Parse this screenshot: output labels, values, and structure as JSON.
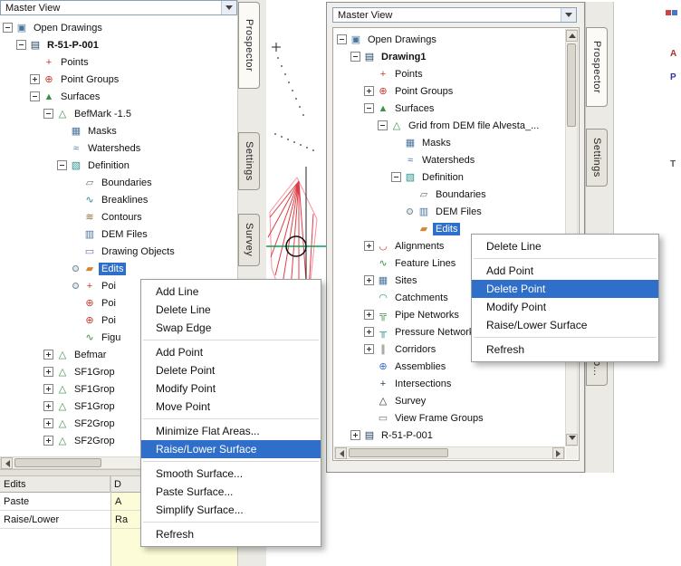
{
  "left_panel": {
    "view_selector": "Master View",
    "tabs": [
      {
        "label": "Prospector",
        "active": true
      },
      {
        "label": "Settings",
        "active": false
      },
      {
        "label": "Survey",
        "active": false
      }
    ],
    "tree": {
      "rows": [
        {
          "label": "Open Drawings",
          "level": 0,
          "expander": "minus",
          "icon": "open_drawings"
        },
        {
          "label": "R-51-P-001",
          "level": 1,
          "expander": "minus",
          "icon": "drawing",
          "bold": true
        },
        {
          "label": "Points",
          "level": 2,
          "expander": null,
          "icon": "points"
        },
        {
          "label": "Point Groups",
          "level": 2,
          "expander": "plus",
          "icon": "point_groups"
        },
        {
          "label": "Surfaces",
          "level": 2,
          "expander": "minus",
          "icon": "surfaces"
        },
        {
          "label": "BefMark -1.5",
          "level": 3,
          "expander": "minus",
          "icon": "surface"
        },
        {
          "label": "Masks",
          "level": 4,
          "expander": null,
          "icon": "masks"
        },
        {
          "label": "Watersheds",
          "level": 4,
          "expander": null,
          "icon": "watersheds"
        },
        {
          "label": "Definition",
          "level": 4,
          "expander": "minus",
          "icon": "definition"
        },
        {
          "label": "Boundaries",
          "level": 5,
          "expander": null,
          "icon": "boundaries"
        },
        {
          "label": "Breaklines",
          "level": 5,
          "expander": null,
          "icon": "breaklines"
        },
        {
          "label": "Contours",
          "level": 5,
          "expander": null,
          "icon": "contours"
        },
        {
          "label": "DEM Files",
          "level": 5,
          "expander": null,
          "icon": "dem_files"
        },
        {
          "label": "Drawing Objects",
          "level": 5,
          "expander": null,
          "icon": "drawing_objects"
        },
        {
          "label": "Edits",
          "level": 5,
          "expander": null,
          "icon": "edits",
          "selected": true,
          "bullet": true
        },
        {
          "label": "Poi",
          "level": 5,
          "expander": null,
          "icon": "point_files",
          "bullet": true,
          "truncated": true
        },
        {
          "label": "Poi",
          "level": 5,
          "expander": null,
          "icon": "point_groups",
          "truncated": true
        },
        {
          "label": "Poi",
          "level": 5,
          "expander": null,
          "icon": "point_groups",
          "truncated": true
        },
        {
          "label": "Figu",
          "level": 5,
          "expander": null,
          "icon": "figures",
          "truncated": true
        },
        {
          "label": "Befmar",
          "level": 3,
          "expander": "plus",
          "icon": "surface",
          "truncated": true
        },
        {
          "label": "SF1Grop",
          "level": 3,
          "expander": "plus",
          "icon": "surface",
          "truncated": true
        },
        {
          "label": "SF1Grop",
          "level": 3,
          "expander": "plus",
          "icon": "surface",
          "truncated": true
        },
        {
          "label": "SF1Grop",
          "level": 3,
          "expander": "plus",
          "icon": "surface",
          "truncated": true
        },
        {
          "label": "SF2Grop",
          "level": 3,
          "expander": "plus",
          "icon": "surface",
          "truncated": true
        },
        {
          "label": "SF2Grop",
          "level": 3,
          "expander": "plus",
          "icon": "surface",
          "truncated": true
        }
      ]
    },
    "list": {
      "columns": [
        "Edits",
        "D"
      ],
      "rows": [
        [
          "Paste",
          "A"
        ],
        [
          "Raise/Lower",
          "Ra"
        ]
      ]
    }
  },
  "right_panel": {
    "view_selector": "Master View",
    "tabs": [
      {
        "label": "Prospector",
        "active": true
      },
      {
        "label": "Settings",
        "active": false
      },
      {
        "label": "To...",
        "active": false
      }
    ],
    "tree": {
      "rows": [
        {
          "label": "Open Drawings",
          "level": 0,
          "expander": "minus",
          "icon": "open_drawings"
        },
        {
          "label": "Drawing1",
          "level": 1,
          "expander": "minus",
          "icon": "drawing",
          "bold": true
        },
        {
          "label": "Points",
          "level": 2,
          "expander": null,
          "icon": "points"
        },
        {
          "label": "Point Groups",
          "level": 2,
          "expander": "plus",
          "icon": "point_groups"
        },
        {
          "label": "Surfaces",
          "level": 2,
          "expander": "minus",
          "icon": "surfaces"
        },
        {
          "label": "Grid from DEM file Alvesta_...",
          "level": 3,
          "expander": "minus",
          "icon": "surface"
        },
        {
          "label": "Masks",
          "level": 4,
          "expander": null,
          "icon": "masks"
        },
        {
          "label": "Watersheds",
          "level": 4,
          "expander": null,
          "icon": "watersheds"
        },
        {
          "label": "Definition",
          "level": 4,
          "expander": "minus",
          "icon": "definition"
        },
        {
          "label": "Boundaries",
          "level": 5,
          "expander": null,
          "icon": "boundaries"
        },
        {
          "label": "DEM Files",
          "level": 5,
          "expander": null,
          "icon": "dem_files",
          "bullet": true
        },
        {
          "label": "Edits",
          "level": 5,
          "expander": null,
          "icon": "edits",
          "selected": true
        },
        {
          "label": "Alignments",
          "level": 2,
          "expander": "plus",
          "icon": "alignments"
        },
        {
          "label": "Feature Lines",
          "level": 2,
          "expander": null,
          "icon": "feature_lines"
        },
        {
          "label": "Sites",
          "level": 2,
          "expander": "plus",
          "icon": "sites"
        },
        {
          "label": "Catchments",
          "level": 2,
          "expander": null,
          "icon": "catchments"
        },
        {
          "label": "Pipe Networks",
          "level": 2,
          "expander": "plus",
          "icon": "pipe_networks"
        },
        {
          "label": "Pressure Networks",
          "level": 2,
          "expander": "plus",
          "icon": "pressure_networks"
        },
        {
          "label": "Corridors",
          "level": 2,
          "expander": "plus",
          "icon": "corridors"
        },
        {
          "label": "Assemblies",
          "level": 2,
          "expander": null,
          "icon": "assemblies"
        },
        {
          "label": "Intersections",
          "level": 2,
          "expander": null,
          "icon": "intersections"
        },
        {
          "label": "Survey",
          "level": 2,
          "expander": null,
          "icon": "survey"
        },
        {
          "label": "View Frame Groups",
          "level": 2,
          "expander": null,
          "icon": "view_frame_groups"
        },
        {
          "label": "R-51-P-001",
          "level": 1,
          "expander": "plus",
          "icon": "drawing"
        }
      ]
    }
  },
  "left_menu": {
    "items": [
      "Add Line",
      "Delete Line",
      "Swap Edge",
      "Add Point",
      "Delete Point",
      "Modify Point",
      "Move Point",
      "Minimize Flat Areas...",
      "Raise/Lower Surface",
      "Smooth Surface...",
      "Paste Surface...",
      "Simplify Surface...",
      "Refresh"
    ],
    "highlighted": "Raise/Lower Surface"
  },
  "right_menu": {
    "items": [
      "Delete Line",
      "Add Point",
      "Delete Point",
      "Modify Point",
      "Raise/Lower Surface",
      "Refresh"
    ],
    "highlighted": "Delete Point"
  },
  "icons": {
    "open_drawings": "▣",
    "drawing": "▤",
    "points": "+",
    "point_groups": "⊕",
    "point_files": "+",
    "figures": "∿",
    "surfaces": "▲",
    "surface": "△",
    "masks": "▦",
    "watersheds": "≈",
    "definition": "▧",
    "boundaries": "▱",
    "breaklines": "∿",
    "contours": "≋",
    "dem_files": "▥",
    "drawing_objects": "▭",
    "edits": "▰",
    "alignments": "◡",
    "feature_lines": "∿",
    "sites": "▦",
    "catchments": "◠",
    "pipe_networks": "╦",
    "pressure_networks": "╥",
    "corridors": "∥",
    "assemblies": "⊕",
    "intersections": "+",
    "survey": "△",
    "view_frame_groups": "▭"
  },
  "right_edge": {
    "marks": [
      "A",
      "P",
      "T"
    ]
  }
}
